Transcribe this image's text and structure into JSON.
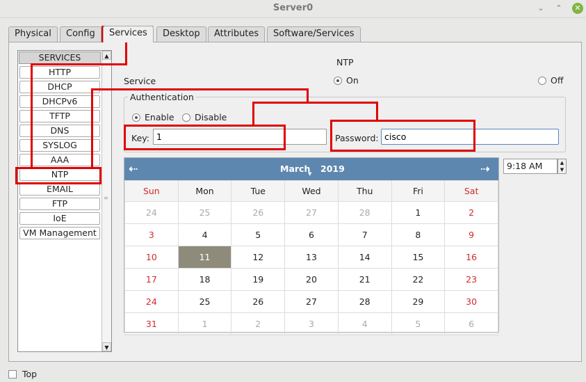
{
  "window": {
    "title": "Server0"
  },
  "tabs": [
    {
      "label": "Physical"
    },
    {
      "label": "Config"
    },
    {
      "label": "Services"
    },
    {
      "label": "Desktop"
    },
    {
      "label": "Attributes"
    },
    {
      "label": "Software/Services"
    }
  ],
  "services": {
    "header": "SERVICES",
    "items": [
      "HTTP",
      "DHCP",
      "DHCPv6",
      "TFTP",
      "DNS",
      "SYSLOG",
      "AAA",
      "NTP",
      "EMAIL",
      "FTP",
      "IoE",
      "VM Management"
    ],
    "selected": "NTP"
  },
  "ntp": {
    "title": "NTP",
    "service_label": "Service",
    "on_label": "On",
    "off_label": "Off",
    "service_state": "On",
    "auth_legend": "Authentication",
    "enable_label": "Enable",
    "disable_label": "Disable",
    "auth_state": "Enable",
    "key_label": "Key:",
    "key_value": "1",
    "password_label": "Password:",
    "password_value": "cisco"
  },
  "calendar": {
    "month": "March",
    "year": "2019",
    "weekdays": [
      "Sun",
      "Mon",
      "Tue",
      "Wed",
      "Thu",
      "Fri",
      "Sat"
    ],
    "weeks": [
      [
        "24",
        "25",
        "26",
        "27",
        "28",
        "1",
        "2"
      ],
      [
        "3",
        "4",
        "5",
        "6",
        "7",
        "8",
        "9"
      ],
      [
        "10",
        "11",
        "12",
        "13",
        "14",
        "15",
        "16"
      ],
      [
        "17",
        "18",
        "19",
        "20",
        "21",
        "22",
        "23"
      ],
      [
        "24",
        "25",
        "26",
        "27",
        "28",
        "29",
        "30"
      ],
      [
        "31",
        "1",
        "2",
        "3",
        "4",
        "5",
        "6"
      ]
    ],
    "selected_day": "11",
    "time": "9:18 AM"
  },
  "footer": {
    "top_label": "Top"
  },
  "colors": {
    "calendar_header": "#5e87b0",
    "highlight": "#e00000",
    "selected_day": "#8e8b7a"
  }
}
